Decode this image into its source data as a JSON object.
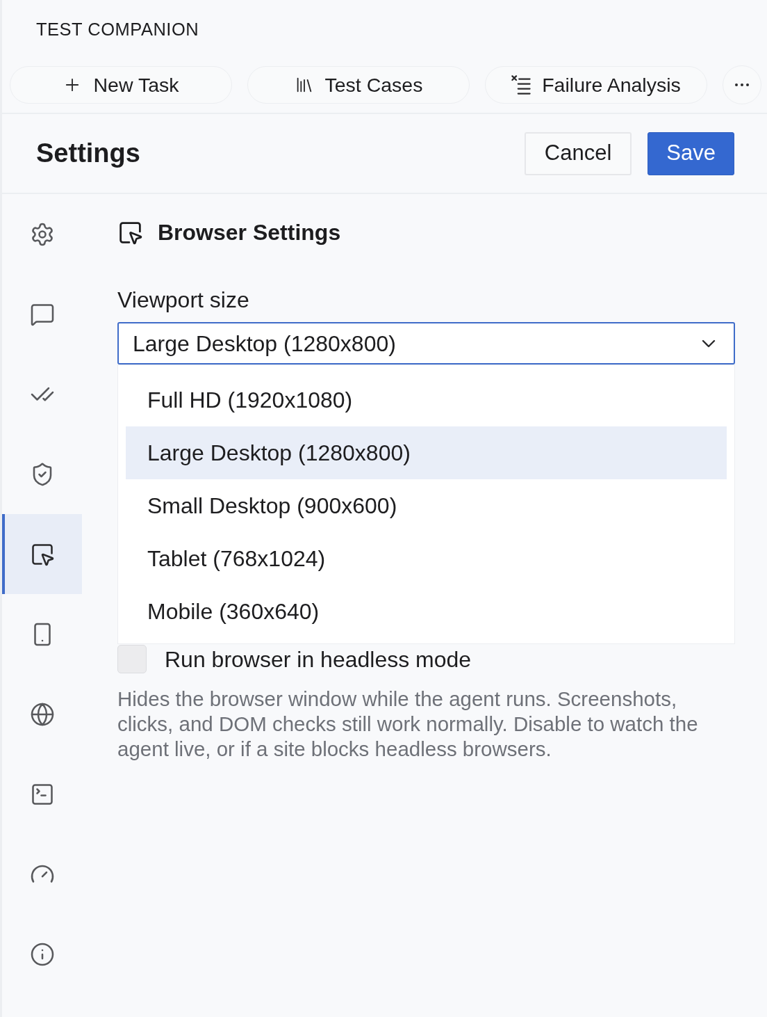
{
  "app": {
    "title": "TEST COMPANION"
  },
  "toolbar": {
    "buttons": [
      {
        "kind": "new",
        "label": "New Task"
      },
      {
        "kind": "cases",
        "label": "Test Cases"
      },
      {
        "kind": "failures",
        "label": "Failure Analysis"
      },
      {
        "kind": "more"
      }
    ]
  },
  "header": {
    "title": "Settings",
    "buttons": [
      {
        "kind": "secondary",
        "label": "Cancel"
      },
      {
        "kind": "primary",
        "label": "Save"
      }
    ]
  },
  "sidebar": {
    "items": [
      {
        "kind": "general",
        "selected": false
      },
      {
        "kind": "chat",
        "selected": false
      },
      {
        "kind": "checks",
        "selected": false
      },
      {
        "kind": "security",
        "selected": false
      },
      {
        "kind": "browser",
        "selected": true
      },
      {
        "kind": "device",
        "selected": false
      },
      {
        "kind": "network",
        "selected": false
      },
      {
        "kind": "terminal",
        "selected": false
      },
      {
        "kind": "performance",
        "selected": false
      },
      {
        "kind": "about",
        "selected": false
      }
    ]
  },
  "section": {
    "title": "Browser Settings",
    "viewport": {
      "label": "Viewport size",
      "value": "Large Desktop (1280x800)",
      "expanded": true,
      "options": [
        {
          "label": "Full HD (1920x1080)",
          "selected": false
        },
        {
          "label": "Large Desktop (1280x800)",
          "selected": true
        },
        {
          "label": "Small Desktop (900x600)",
          "selected": false
        },
        {
          "label": "Tablet (768x1024)",
          "selected": false
        },
        {
          "label": "Mobile (360x640)",
          "selected": false
        }
      ]
    },
    "headless": {
      "label": "Run browser in headless mode",
      "checked": false,
      "description": "Hides the browser window while the agent runs. Screenshots, clicks, and DOM checks still work normally. Disable to watch the agent live, or if a site blocks headless browsers."
    }
  }
}
